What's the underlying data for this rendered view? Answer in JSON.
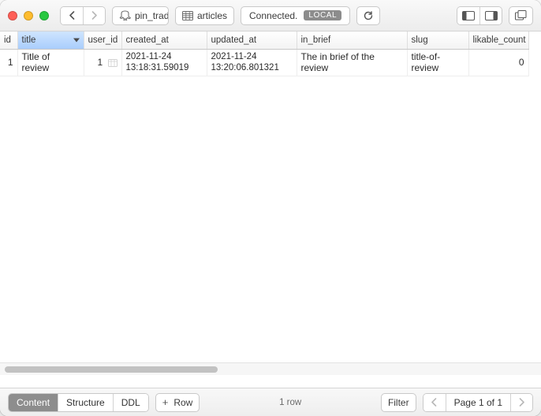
{
  "toolbar": {
    "db_label": "pin_trade",
    "table_label": "articles",
    "status": "Connected.",
    "status_tag": "LOCAL"
  },
  "columns": [
    "id",
    "title",
    "user_id",
    "created_at",
    "updated_at",
    "in_brief",
    "slug",
    "likable_count"
  ],
  "sorted_column": "title",
  "rows": [
    {
      "id": "1",
      "title": "Title of review",
      "user_id": "1",
      "created_at": "2021-11-24 13:18:31.59019",
      "updated_at": "2021-11-24 13:20:06.801321",
      "in_brief": "The in brief of the review",
      "slug": "title-of-review",
      "likable_count": "0"
    }
  ],
  "bottom": {
    "tab_content": "Content",
    "tab_structure": "Structure",
    "tab_ddl": "DDL",
    "add_row": "Row",
    "row_count": "1 row",
    "filter": "Filter",
    "page_label": "Page 1 of 1"
  }
}
